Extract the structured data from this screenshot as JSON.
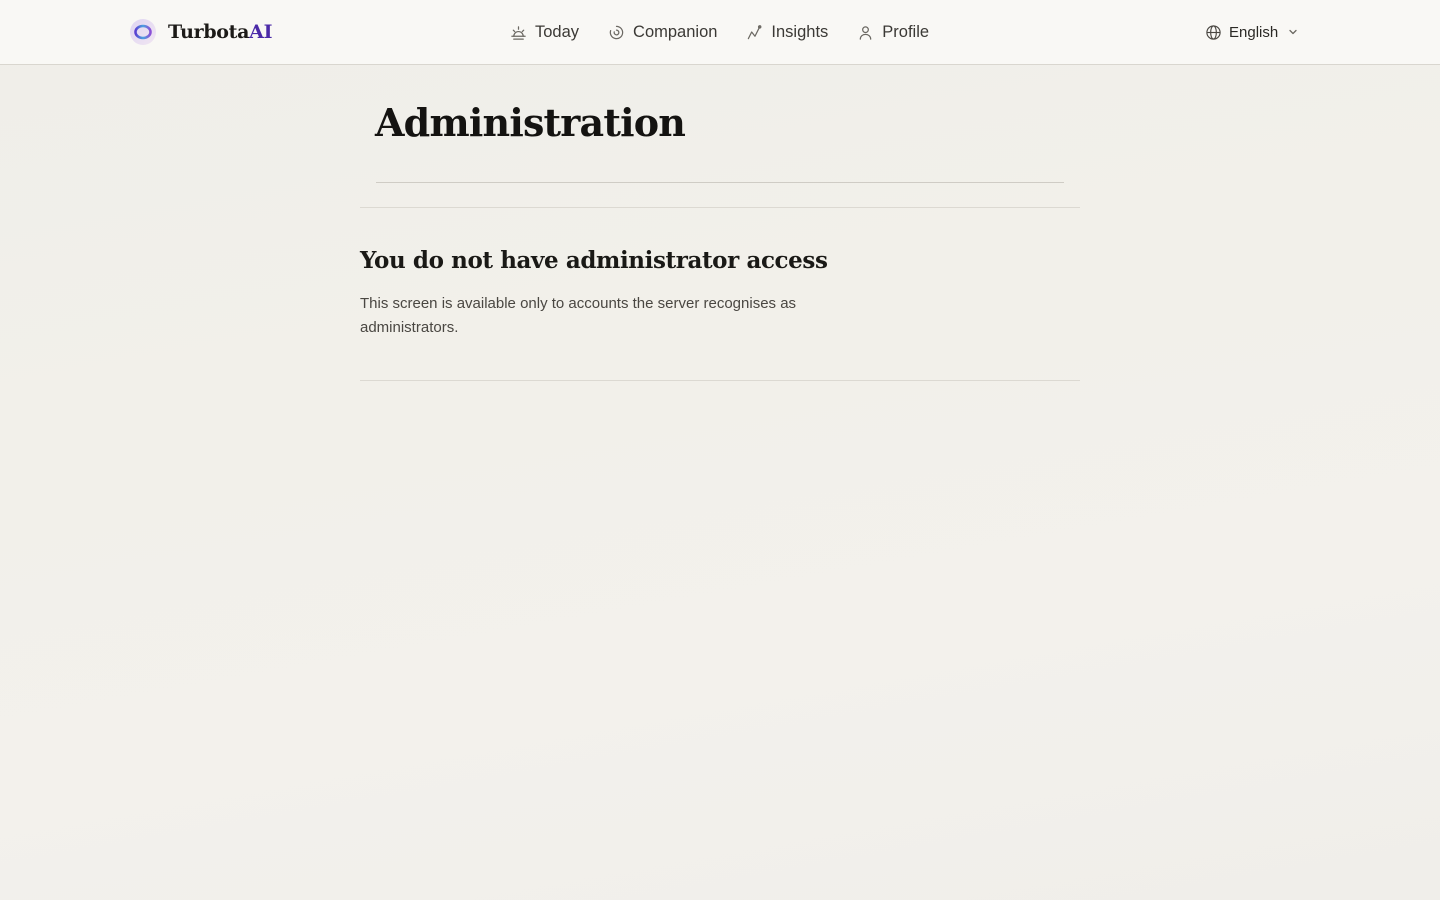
{
  "brand": {
    "name_main": "Turbota",
    "name_accent": "AI"
  },
  "nav": {
    "items": [
      {
        "label": "Today",
        "icon": "sunrise-icon"
      },
      {
        "label": "Companion",
        "icon": "companion-icon"
      },
      {
        "label": "Insights",
        "icon": "insights-icon"
      },
      {
        "label": "Profile",
        "icon": "user-icon"
      }
    ]
  },
  "language": {
    "selected": "English",
    "icon": "globe-icon"
  },
  "page": {
    "title": "Administration",
    "notice": {
      "title": "You do not have administrator access",
      "body": "This screen is available only to accounts the server recognises as administrators."
    }
  },
  "colors": {
    "accent": "#4b2aa8",
    "background": "#f2f0ea",
    "header": "#f9f8f5"
  }
}
